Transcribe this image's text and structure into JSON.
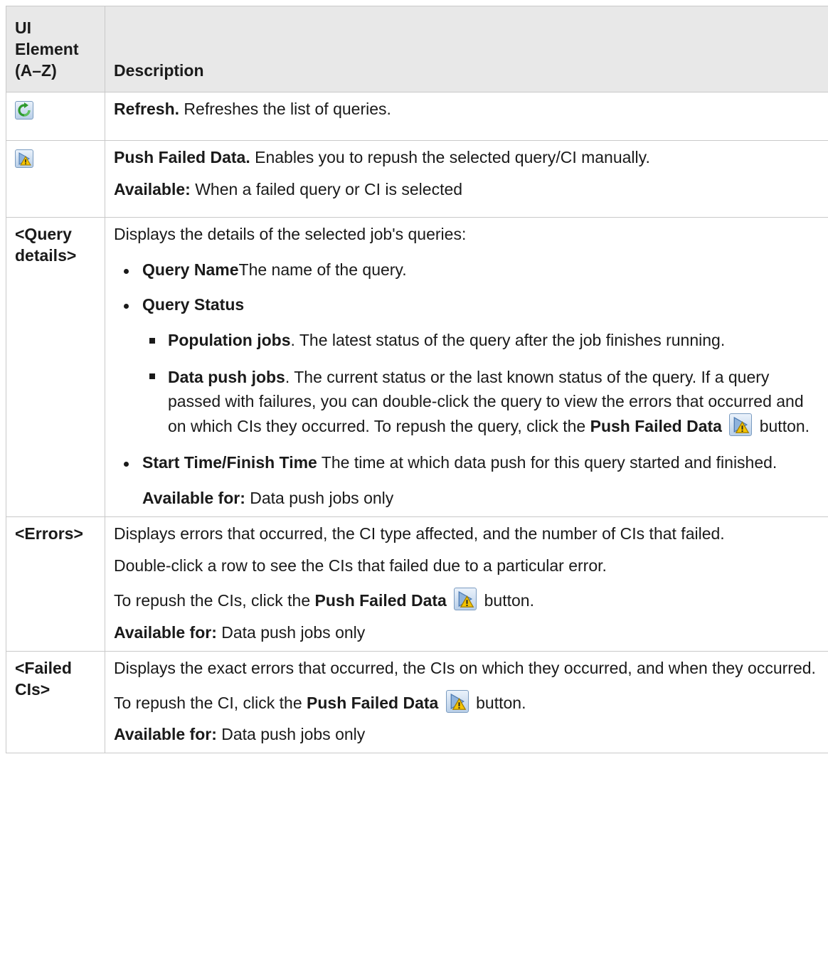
{
  "header": {
    "col1": "UI Element (A–Z)",
    "col2": "Description"
  },
  "rows": {
    "refresh": {
      "title": "Refresh.",
      "text": " Refreshes the list of queries."
    },
    "push": {
      "title": "Push Failed Data.",
      "text": " Enables you to repush the selected query/CI manually.",
      "avail_label": "Available:",
      "avail_text": " When a failed query or CI is selected"
    },
    "query": {
      "element": "<Query details>",
      "intro": "Displays the details of the selected job's queries:",
      "name_label": "Query Name",
      "name_text": "The name of the query.",
      "status_label": "Query Status",
      "pop_label": "Population jobs",
      "pop_text": ". The latest status of the query after the job finishes running.",
      "dp_label": "Data push jobs",
      "dp_text": ". The current status or the last known status of the query. If a query passed with failures, you can double-click the query to view the errors that occurred and on which CIs they occurred. To repush the query, click the ",
      "dp_button": "Push Failed Data",
      "dp_end": " button.",
      "time_label": "Start Time/Finish Time",
      "time_text": " The time at which data push for this query started and finished.",
      "avail_label": "Available for:",
      "avail_text": " Data push jobs only"
    },
    "errors": {
      "element": "<Errors>",
      "p1": "Displays errors that occurred, the CI type affected, and the number of CIs that failed.",
      "p2": "Double-click a row to see the CIs that failed due to a particular error.",
      "p3_pre": "To repush the CIs, click the ",
      "p3_button": "Push Failed Data",
      "p3_end": " button.",
      "avail_label": "Available for:",
      "avail_text": " Data push jobs only"
    },
    "failed": {
      "element": "<Failed CIs>",
      "p1": "Displays the exact errors that occurred, the CIs on which they occurred, and when they occurred.",
      "p2_pre": "To repush the CI, click the ",
      "p2_button": "Push Failed Data",
      "p2_end": " button.",
      "avail_label": "Available for:",
      "avail_text": " Data push jobs only"
    }
  },
  "icons": {
    "refresh": "refresh-icon",
    "push": "push-failed-data-icon",
    "accent_green": "#2e9a2e",
    "accent_yellow": "#f5c400"
  }
}
